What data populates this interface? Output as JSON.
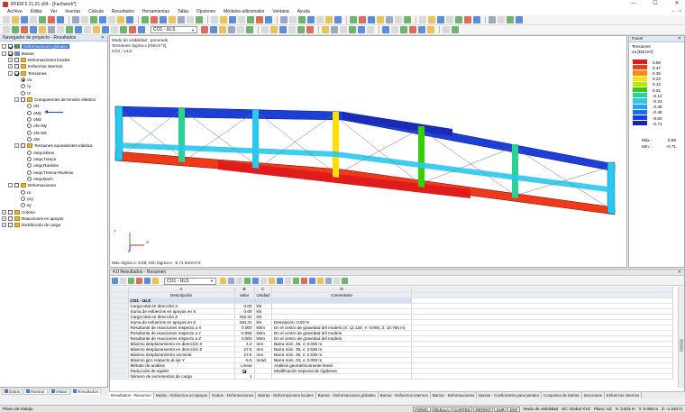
{
  "window": {
    "title": "RFEM 5.21.01 x64 - [Fachwerk*]",
    "controls": [
      "—",
      "☐",
      "✕"
    ]
  },
  "menu": {
    "items": [
      "Archivo",
      "Editar",
      "Ver",
      "Insertar",
      "Cálculo",
      "Resultados",
      "Herramientas",
      "Tabla",
      "Opciones",
      "Módulos adicionales",
      "Ventana",
      "Ayuda"
    ],
    "mdi_controls": "– ▫ ×"
  },
  "toolbar": {
    "load_case": "CO1 - ULS"
  },
  "navigator": {
    "title": "Navegador de proyecto - Resultados",
    "items": [
      {
        "label": "Deformaciones globales",
        "level": 0,
        "exp": "-",
        "check": "cb-on",
        "icon": "res",
        "selected": true
      },
      {
        "label": "Barras",
        "level": 0,
        "exp": "-",
        "check": "cb-on",
        "icon": "beam"
      },
      {
        "label": "Deformaciones locales",
        "level": 1,
        "exp": "+",
        "check": "cb",
        "icon": "folder"
      },
      {
        "label": "Esfuerzos internos",
        "level": 1,
        "exp": "+",
        "check": "cb",
        "icon": "folder"
      },
      {
        "label": "Tensiones",
        "level": 1,
        "exp": "-",
        "check": "cb-on",
        "icon": "folder"
      },
      {
        "label": "σx",
        "level": 2,
        "exp": "",
        "check": "radio-on",
        "icon": ""
      },
      {
        "label": "τy",
        "level": 2,
        "exp": "",
        "check": "radio",
        "icon": ""
      },
      {
        "label": "τz",
        "level": 2,
        "exp": "",
        "check": "radio",
        "icon": ""
      },
      {
        "label": "Componentes de tensión elástico",
        "level": 2,
        "exp": "-",
        "check": "cb",
        "icon": "folder"
      },
      {
        "label": "σN",
        "level": 3,
        "exp": "",
        "check": "radio",
        "icon": ""
      },
      {
        "label": "σMy",
        "level": 3,
        "exp": "",
        "check": "radio",
        "icon": ""
      },
      {
        "label": "σMz",
        "level": 3,
        "exp": "",
        "check": "radio",
        "icon": ""
      },
      {
        "label": "σN+My",
        "level": 3,
        "exp": "",
        "check": "radio",
        "icon": ""
      },
      {
        "label": "σN+Mz",
        "level": 3,
        "exp": "",
        "check": "radio",
        "icon": ""
      },
      {
        "label": "σM",
        "level": 3,
        "exp": "",
        "check": "radio",
        "icon": ""
      },
      {
        "label": "Tensiones equivalentes elástica",
        "level": 2,
        "exp": "-",
        "check": "cb",
        "icon": "folder"
      },
      {
        "label": "σeqv,Mises",
        "level": 3,
        "exp": "",
        "check": "radio",
        "icon": ""
      },
      {
        "label": "σeqv,Tresca",
        "level": 3,
        "exp": "",
        "check": "radio",
        "icon": ""
      },
      {
        "label": "σeqv,Rankine",
        "level": 3,
        "exp": "",
        "check": "radio",
        "icon": ""
      },
      {
        "label": "σeqv,Tresca+Rankine",
        "level": 3,
        "exp": "",
        "check": "radio",
        "icon": ""
      },
      {
        "label": "σeqv,Bach",
        "level": 3,
        "exp": "",
        "check": "radio",
        "icon": ""
      },
      {
        "label": "Deformaciones",
        "level": 1,
        "exp": "-",
        "check": "cb",
        "icon": "folder"
      },
      {
        "label": "εx",
        "level": 2,
        "exp": "",
        "check": "radio",
        "icon": ""
      },
      {
        "label": "γxy",
        "level": 2,
        "exp": "",
        "check": "radio",
        "icon": ""
      },
      {
        "label": "κy",
        "level": 2,
        "exp": "",
        "check": "radio",
        "icon": ""
      },
      {
        "label": "Criterio",
        "level": 0,
        "exp": "+",
        "check": "cb",
        "icon": "folder"
      },
      {
        "label": "Reacciones en apoyos",
        "level": 0,
        "exp": "+",
        "check": "cb",
        "icon": "folder"
      },
      {
        "label": "Distribución de carga",
        "level": 0,
        "exp": "+",
        "check": "cb",
        "icon": "folder"
      }
    ],
    "tabs": [
      "Datos",
      "Mostrar",
      "Vistas",
      "Resultados"
    ]
  },
  "viewport": {
    "line1": "Modo de visibilidad : generado",
    "line2": "Tensiones Sigma-x [kN/cm^2]",
    "line3": "CO1 : ULS",
    "footer": "Máx Sigma-x: 0.58, Mín Sigma-x: -0.71 kN/cm^2",
    "axis_y": "Y",
    "axis_x": "X",
    "axis_z": "Z"
  },
  "legend": {
    "panel_title": "Panel",
    "title": "Tensiones",
    "unit": "σx [kN/cm²]",
    "values": [
      "0.58",
      "0.47",
      "0.35",
      "0.23",
      "0.12",
      "0.01",
      "-0.12",
      "-0.24",
      "-0.36",
      "-0.48",
      "-0.60",
      "-0.71"
    ],
    "colors": [
      "#e01b1b",
      "#ee3a18",
      "#f48e1c",
      "#ffe000",
      "#b9e800",
      "#36d000",
      "#27d493",
      "#29c8ee",
      "#1fa6ee",
      "#1b6ef0",
      "#1a3ce8",
      "#1622b8"
    ],
    "max_label": "Máx :",
    "max_value": "0.58",
    "min_label": "Mín :",
    "min_value": "-0.71"
  },
  "results": {
    "title": "4.0 Resultados - Resumen",
    "load_case": "CO1 - ULS",
    "col_letters": [
      "A",
      "B",
      "C",
      "D"
    ],
    "headers": [
      "Descripción",
      "Valor",
      "Unidad",
      "Comentario"
    ],
    "group": "CO1 - ULS",
    "rows": [
      {
        "desc": "Carga total en dirección X",
        "val": "0.00",
        "unit": "kN",
        "comment": ""
      },
      {
        "desc": "Suma de esfuerzos en apoyos en X",
        "val": "0.00",
        "unit": "kN",
        "comment": ""
      },
      {
        "desc": "Carga total en dirección Z",
        "val": "433.31",
        "unit": "kN",
        "comment": ""
      },
      {
        "desc": "Suma de esfuerzos en apoyos en Z",
        "val": "433.31",
        "unit": "kN",
        "comment": "Desviación:  0.00 %"
      },
      {
        "desc": "Resultante de reacciones respecto a X",
        "val": "0.000",
        "unit": "kNm",
        "comment": "En el centro de gravedad del modelo (X: 12.120, Y: 0.000, Z: 10.766 m)"
      },
      {
        "desc": "Resultante de reacciones respecto a Y",
        "val": "-0.958",
        "unit": "kNm",
        "comment": "En el centro de gravedad del modelo"
      },
      {
        "desc": "Resultante de reacciones respecto a Z",
        "val": "0.000",
        "unit": "kNm",
        "comment": "En el centro de gravedad del modelo"
      },
      {
        "desc": "Máximo desplazamiento en dirección X",
        "val": "4.4",
        "unit": "mm",
        "comment": "Barra núm. 36,  x: 0.000 m"
      },
      {
        "desc": "Máximo desplazamiento en dirección Z",
        "val": "27.5",
        "unit": "mm",
        "comment": "Barra núm. 35,  x: 2.535 m"
      },
      {
        "desc": "Máximo desplazamiento vectorial",
        "val": "27.6",
        "unit": "mm",
        "comment": "Barra núm. 35,  x: 2.535 m"
      },
      {
        "desc": "Máximo giro respecto al eje Y",
        "val": "-5.6",
        "unit": "mrad",
        "comment": "Barra núm. 33,  x: 0.000 m"
      },
      {
        "desc": "Método de análisis",
        "val": "Lineal",
        "unit": "",
        "comment": "Análisis geométricamente lineal"
      },
      {
        "desc": "Reducción de rigidez",
        "val": "",
        "unit": "",
        "comment": "Modificación especial de rigideces",
        "check": true
      },
      {
        "desc": "Número de incrementos de carga",
        "val": "1",
        "unit": "",
        "comment": ""
      }
    ],
    "tabs": [
      "Resultados - Resumen",
      "Nudos - Esfuerzos en apoyos",
      "Nudos - Deformaciones",
      "Barras - Deformaciones locales",
      "Barras - Deformaciones globales",
      "Barras - Esfuerzos internos",
      "Barras - Deformaciones",
      "Barras - Coeficientes para pandeo",
      "Conjuntos de barras",
      "Secciones",
      "Esfuerzos internos"
    ]
  },
  "status": {
    "message": "Plano de trabajo",
    "buttons": [
      "FORZC",
      "REJILLA",
      "CARTES",
      "REFENT",
      "SUR",
      "DXF"
    ],
    "mode": "Modo de visibilidad",
    "sc": "SC: Global XYZ",
    "plane": "Plano: XZ",
    "x": "X: 3.623 m",
    "y": "Y: 0.000 m",
    "z": "Z: -1.193 m"
  }
}
